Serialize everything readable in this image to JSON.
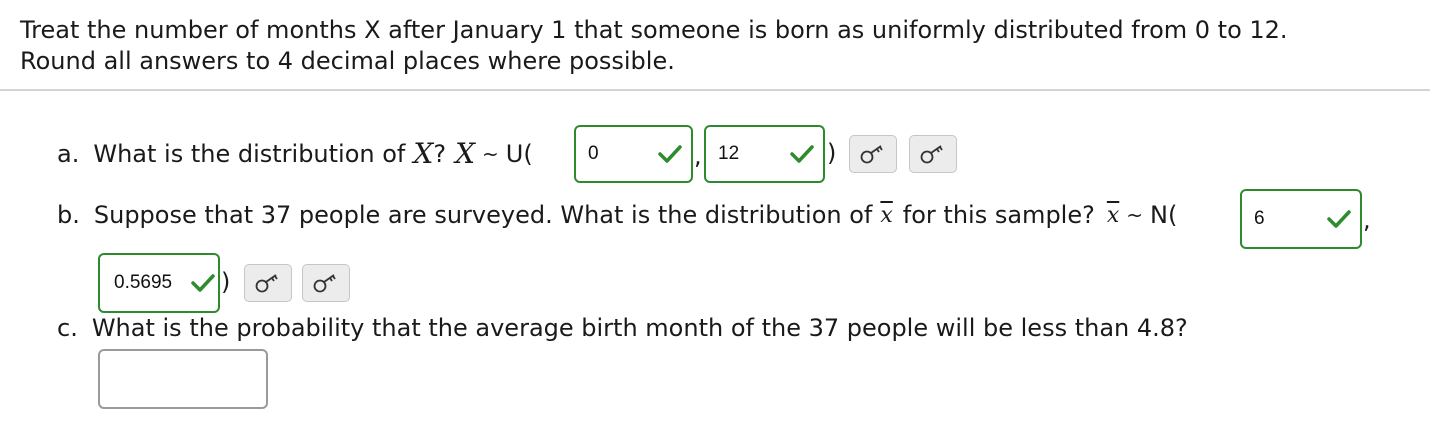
{
  "intro": {
    "line1": "Treat the number of months X after January 1 that someone is born as uniformly distributed from 0 to 12.",
    "line2": "Round all answers to 4 decimal places where possible."
  },
  "part_a": {
    "label": "a.",
    "text": "What is the distribution of",
    "var_x": "X",
    "after_var": "?",
    "var_x2": "X",
    "tilde": "~",
    "dist": "U(",
    "answer1": "0",
    "answer2": "12",
    "comma": ",",
    "close": ")"
  },
  "part_b": {
    "label": "b.",
    "text": "Suppose that 37 people are surveyed.  What is the distribution of",
    "var_xbar": "x",
    "text2": "for this sample?",
    "var_xbar2": "x",
    "tilde": "~",
    "dist": "N(",
    "answer1": "6",
    "comma": ",",
    "answer2": "0.5695",
    "close": ")"
  },
  "part_c": {
    "label": "c.",
    "text": "What is the probability that the average birth month of the 37 people will be less than 4.8?",
    "answer": ""
  },
  "icons": {
    "correct": "checkmark-icon",
    "key": "key-icon"
  },
  "colors": {
    "correct_border": "#2f8a2f",
    "check": "#2e8b2e",
    "empty_border": "#9a9a9a"
  }
}
